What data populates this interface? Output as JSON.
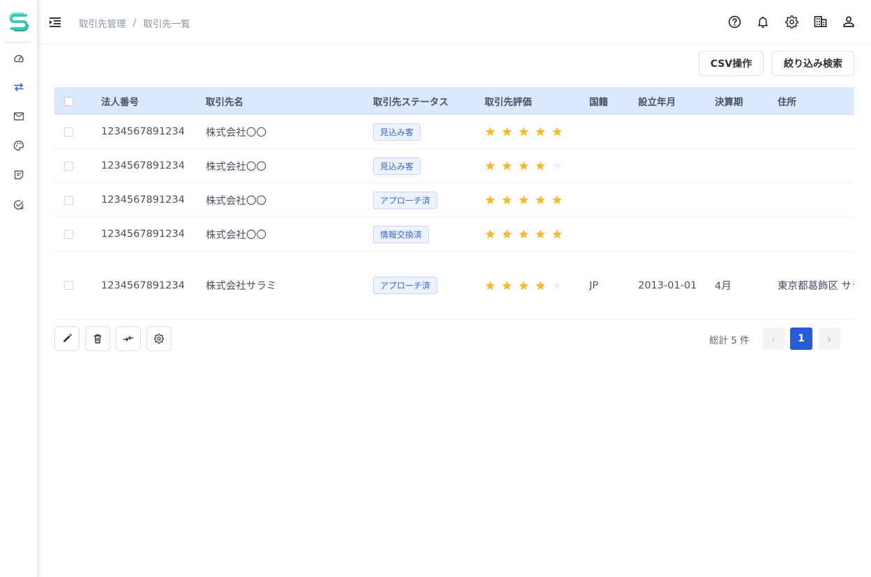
{
  "breadcrumb": {
    "parent": "取引先管理",
    "separator": "/",
    "current": "取引先一覧"
  },
  "actions": {
    "csv_label": "CSV操作",
    "filter_label": "絞り込み検索"
  },
  "table": {
    "columns": {
      "corporate_number": "法人番号",
      "name": "取引先名",
      "status": "取引先ステータス",
      "rating": "取引先評価",
      "nationality": "国籍",
      "established": "設立年月",
      "fiscal_period": "決算期",
      "address": "住所"
    },
    "rows": [
      {
        "corporate_number": "1234567891234",
        "name": "株式会社〇〇",
        "status": "見込み客",
        "rating": 5,
        "nationality": "",
        "established": "",
        "fiscal_period": "",
        "address": ""
      },
      {
        "corporate_number": "1234567891234",
        "name": "株式会社〇〇",
        "status": "見込み客",
        "rating": 4,
        "nationality": "",
        "established": "",
        "fiscal_period": "",
        "address": ""
      },
      {
        "corporate_number": "1234567891234",
        "name": "株式会社〇〇",
        "status": "アプローチ済",
        "rating": 5,
        "nationality": "",
        "established": "",
        "fiscal_period": "",
        "address": ""
      },
      {
        "corporate_number": "1234567891234",
        "name": "株式会社〇〇",
        "status": "情報交換済",
        "rating": 5,
        "nationality": "",
        "established": "",
        "fiscal_period": "",
        "address": ""
      },
      {
        "corporate_number": "1234567891234",
        "name": "株式会社サラミ",
        "status": "アプローチ済",
        "rating": 4,
        "nationality": "JP",
        "established": "2013-01-01",
        "fiscal_period": "4月",
        "address": "東京都葛飾区 サラミ"
      }
    ],
    "max_rating": 5
  },
  "pagination": {
    "total_label": "総計 5 件",
    "current_page": "1",
    "prev_icon": "‹",
    "next_icon": "›"
  },
  "colors": {
    "accent": "#2a5bd7",
    "header_bg": "#dbe7fc",
    "star_on": "#f7ba2a",
    "star_off": "#eff2f7",
    "tag_text": "#3466d6"
  },
  "icons": {
    "sidebar": [
      "dashboard-icon",
      "transfer-icon",
      "mail-icon",
      "palette-icon",
      "note-icon",
      "task-check-icon"
    ],
    "header": [
      "help-icon",
      "bell-icon",
      "gear-icon",
      "building-icon",
      "user-icon"
    ],
    "toolbar": [
      "edit-icon",
      "trash-icon",
      "merge-icon",
      "settings-icon"
    ]
  }
}
